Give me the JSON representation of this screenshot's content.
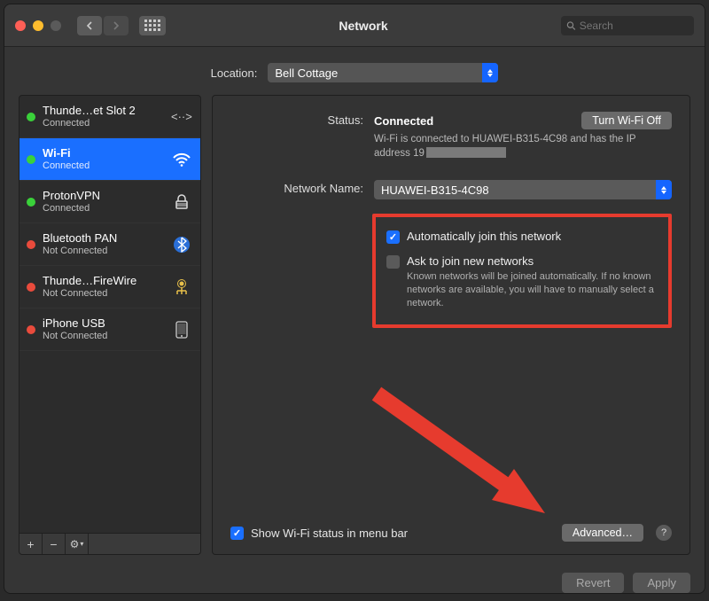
{
  "window": {
    "title": "Network",
    "search_placeholder": "Search"
  },
  "location": {
    "label": "Location:",
    "value": "Bell Cottage"
  },
  "sidebar": {
    "items": [
      {
        "name": "Thunde…et Slot 2",
        "sub": "Connected",
        "status": "green",
        "icon": "thunderbolt-bridge"
      },
      {
        "name": "Wi-Fi",
        "sub": "Connected",
        "status": "green",
        "icon": "wifi",
        "selected": true
      },
      {
        "name": "ProtonVPN",
        "sub": "Connected",
        "status": "green",
        "icon": "lock"
      },
      {
        "name": "Bluetooth PAN",
        "sub": "Not Connected",
        "status": "red",
        "icon": "bluetooth"
      },
      {
        "name": "Thunde…FireWire",
        "sub": "Not Connected",
        "status": "red",
        "icon": "firewire"
      },
      {
        "name": "iPhone USB",
        "sub": "Not Connected",
        "status": "red",
        "icon": "phone"
      }
    ],
    "footer": {
      "add": "+",
      "remove": "−",
      "gear": "⚙︎"
    }
  },
  "main": {
    "status_label": "Status:",
    "status_value": "Connected",
    "wifi_off_button": "Turn Wi-Fi Off",
    "status_desc_prefix": "Wi-Fi is connected to HUAWEI-B315-4C98 and has the IP address 19",
    "network_name_label": "Network Name:",
    "network_name_value": "HUAWEI-B315-4C98",
    "auto_join_label": "Automatically join this network",
    "ask_join_label": "Ask to join new networks",
    "ask_join_desc": "Known networks will be joined automatically. If no known networks are available, you will have to manually select a network.",
    "show_menubar_label": "Show Wi-Fi status in menu bar",
    "advanced_button": "Advanced…",
    "help": "?"
  },
  "footer": {
    "revert": "Revert",
    "apply": "Apply"
  }
}
